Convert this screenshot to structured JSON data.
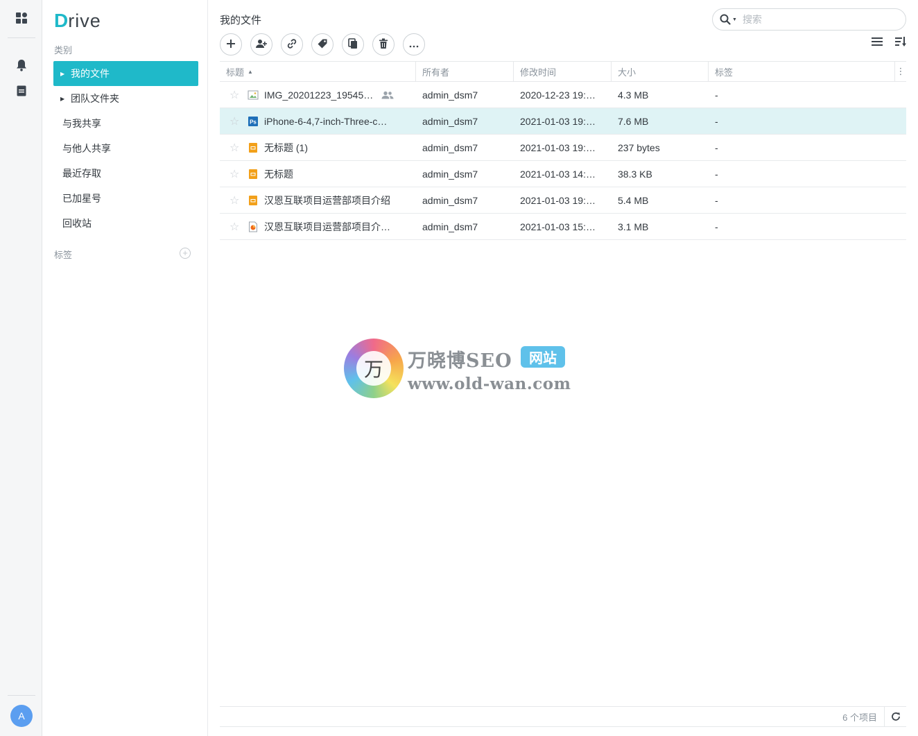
{
  "app": {
    "logo_initial": "D",
    "logo_rest": "rive",
    "accent_color": "#1fb9c9"
  },
  "rail": {
    "icons": [
      "dashboard-icon",
      "bell-icon",
      "document-icon"
    ],
    "avatar_letter": "A"
  },
  "sidebar": {
    "category_label": "类别",
    "items": [
      {
        "label": "我的文件",
        "active": true,
        "has_caret": true
      },
      {
        "label": "团队文件夹",
        "active": false,
        "has_caret": true
      },
      {
        "label": "与我共享",
        "active": false,
        "has_caret": false
      },
      {
        "label": "与他人共享",
        "active": false,
        "has_caret": false
      },
      {
        "label": "最近存取",
        "active": false,
        "has_caret": false
      },
      {
        "label": "已加星号",
        "active": false,
        "has_caret": false
      },
      {
        "label": "回收站",
        "active": false,
        "has_caret": false
      }
    ],
    "tags_label": "标签"
  },
  "main": {
    "title": "我的文件",
    "search_placeholder": "搜索",
    "toolbar": [
      "add-icon",
      "share-user-icon",
      "link-icon",
      "tag-icon",
      "copy-icon",
      "delete-icon",
      "more-icon"
    ],
    "columns": [
      "标题",
      "所有者",
      "修改时间",
      "大小",
      "标签"
    ],
    "sort_column": "标题",
    "sort_direction": "ascending",
    "files": [
      {
        "name": "IMG_20201223_19545…",
        "icon": "image-file-icon",
        "shared": true,
        "owner": "admin_dsm7",
        "modified": "2020-12-23 19:…",
        "size": "4.3 MB",
        "tags": "-",
        "selected": false
      },
      {
        "name": "iPhone-6-4,7-inch-Three-c…",
        "icon": "photoshop-file-icon",
        "shared": false,
        "owner": "admin_dsm7",
        "modified": "2021-01-03 19:…",
        "size": "7.6 MB",
        "tags": "-",
        "selected": true
      },
      {
        "name": "无标题 (1)",
        "icon": "slides-file-icon",
        "shared": false,
        "owner": "admin_dsm7",
        "modified": "2021-01-03 19:…",
        "size": "237 bytes",
        "tags": "-",
        "selected": false
      },
      {
        "name": "无标题",
        "icon": "slides-file-icon",
        "shared": false,
        "owner": "admin_dsm7",
        "modified": "2021-01-03 14:…",
        "size": "38.3 KB",
        "tags": "-",
        "selected": false
      },
      {
        "name": "汉恩互联项目运营部项目介绍",
        "icon": "slides-file-icon",
        "shared": false,
        "owner": "admin_dsm7",
        "modified": "2021-01-03 19:…",
        "size": "5.4 MB",
        "tags": "-",
        "selected": false
      },
      {
        "name": "汉恩互联项目运营部项目介…",
        "icon": "powerpoint-file-icon",
        "shared": false,
        "owner": "admin_dsm7",
        "modified": "2021-01-03 15:…",
        "size": "3.1 MB",
        "tags": "-",
        "selected": false
      }
    ],
    "footer_count": "6 个项目"
  },
  "watermark": {
    "glyph": "万",
    "title": "万晓博SEO",
    "badge": "网站",
    "url": "www.old-wan.com"
  }
}
